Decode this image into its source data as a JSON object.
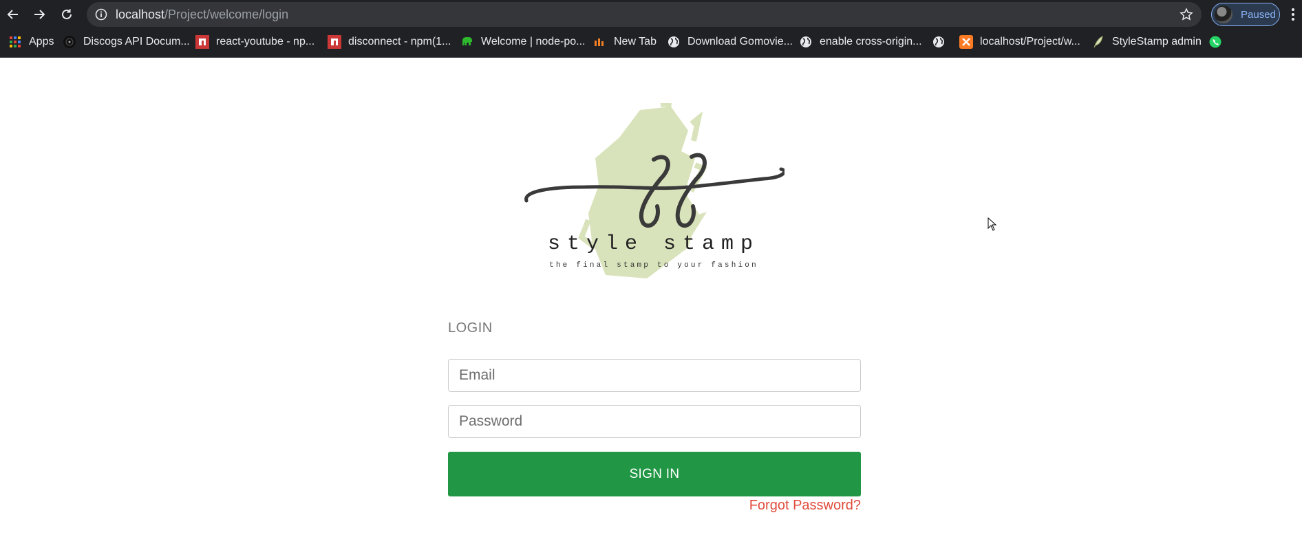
{
  "browser": {
    "url_host": "localhost",
    "url_path": "/Project/welcome/login",
    "profile_label": "Paused",
    "bookmarks": [
      {
        "label": "Apps",
        "icon": "apps-grid-icon"
      },
      {
        "label": "Discogs API Docum...",
        "icon": "discogs-icon"
      },
      {
        "label": "react-youtube - np...",
        "icon": "npm-icon"
      },
      {
        "label": "disconnect - npm(1...",
        "icon": "npm-icon"
      },
      {
        "label": "Welcome | node-po...",
        "icon": "elephant-icon"
      },
      {
        "label": "New Tab",
        "icon": "new-tab-icon"
      },
      {
        "label": "Download Gomovie...",
        "icon": "globe-icon"
      },
      {
        "label": "enable cross-origin...",
        "icon": "globe-icon"
      },
      {
        "label": "",
        "icon": "globe-icon"
      },
      {
        "label": "localhost/Project/w...",
        "icon": "xampp-icon"
      },
      {
        "label": "StyleStamp admin",
        "icon": "feather-icon"
      },
      {
        "label": "",
        "icon": "whatsapp-icon"
      }
    ]
  },
  "logo": {
    "monogram": "SS",
    "name": "style stamp",
    "tagline": "the final stamp to your fashion",
    "brush_color": "#d9e3bb"
  },
  "login": {
    "title": "LOGIN",
    "email_placeholder": "Email",
    "password_placeholder": "Password",
    "signin_label": "SIGN IN",
    "forgot_label": "Forgot Password?"
  },
  "colors": {
    "primary_button": "#219745",
    "forgot_link": "#e04b3a",
    "chrome_bg": "#202124"
  }
}
